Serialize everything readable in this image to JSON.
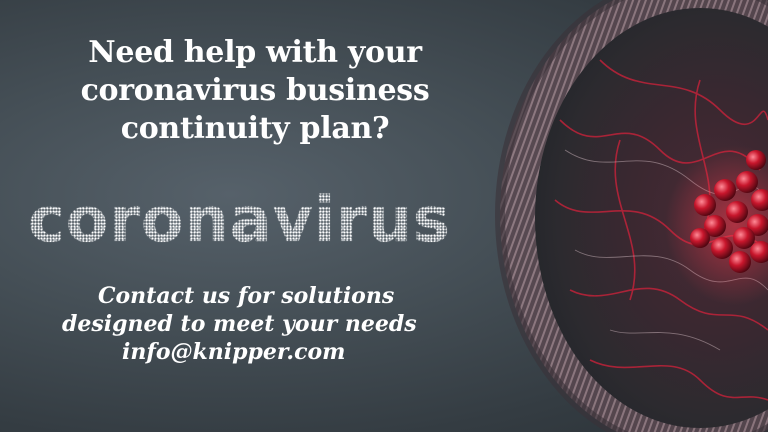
{
  "headline": {
    "line1": "Need help with your",
    "line2": "coronavirus business",
    "line3": "continuity plan?"
  },
  "word_art": {
    "text": "coronavirus"
  },
  "contact": {
    "line1": "Contact us for  solutions",
    "line2": "designed to meet your needs",
    "line3": "info@knipper.com"
  },
  "colors": {
    "background": "#3f484e",
    "text": "#ffffff",
    "virus_red": "#c0182a",
    "virus_membrane": "#7a6670"
  },
  "icons": {
    "illustration": "coronavirus-cell-image"
  }
}
